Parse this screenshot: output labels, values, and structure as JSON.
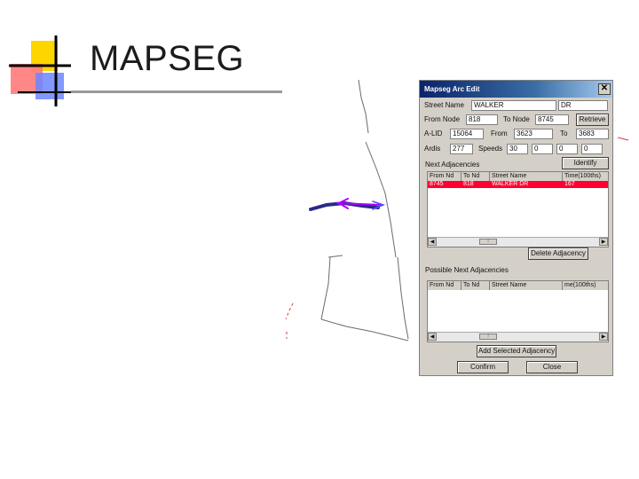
{
  "slide": {
    "title": "MAPSEG"
  },
  "dialog": {
    "title": "Mapseg Arc Edit",
    "close_icon": "close-icon",
    "street_name_label": "Street Name",
    "street_name_value": "WALKER",
    "street_suffix_value": "DR",
    "from_node_label": "From Node",
    "from_node_value": "818",
    "to_node_label": "To Node",
    "to_node_value": "8745",
    "retrieve_button": "Retrieve",
    "arc_id_label": "A-LID",
    "arc_id_value": "15064",
    "from_label": "From",
    "from_value": "3623",
    "to_label": "To",
    "to_value": "3683",
    "ardis_label": "Ardis",
    "ardis_value": "277",
    "speeds_label": "Speeds",
    "speed_values": [
      "30",
      "0",
      "0",
      "0"
    ],
    "identify_button": "Identify",
    "next_adj_label": "Next Adjacencies",
    "grid1_headers": [
      "From Nd",
      "To Nd",
      "Street Name",
      "Time(100ths)"
    ],
    "grid1_rows": [
      [
        "8745",
        "818",
        "WALKER DR",
        "167"
      ]
    ],
    "delete_adj_button": "Delete Adjacency",
    "possible_adj_label": "Possible Next Adjacencies",
    "grid2_headers": [
      "From Nd",
      "To Nd",
      "Street Name",
      "me(100ths)"
    ],
    "add_adj_button": "Add Selected Adjacency",
    "confirm_button": "Confirm",
    "close_button": "Close"
  },
  "colors": {
    "selected_row": "#ff0033",
    "arrow": "#8a00c8",
    "logo_yellow": "#ffd500",
    "logo_red": "#ff4b4b",
    "logo_blue": "#5b7bff"
  }
}
